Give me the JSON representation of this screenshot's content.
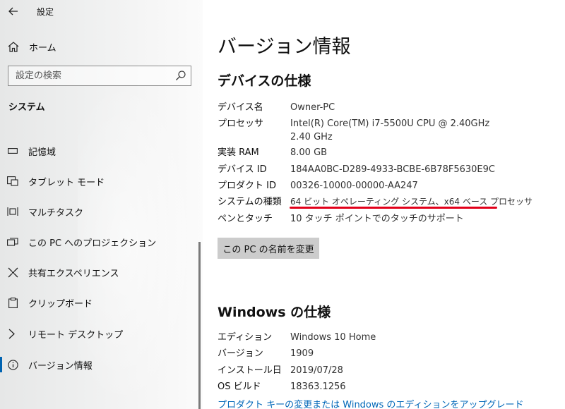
{
  "app": {
    "title": "設定"
  },
  "sidebar": {
    "home_label": "ホーム",
    "search_placeholder": "設定の検索",
    "section_label": "システム",
    "items": [
      {
        "label": "記憶域",
        "icon": "storage-icon"
      },
      {
        "label": "タブレット モード",
        "icon": "tablet-mode-icon"
      },
      {
        "label": "マルチタスク",
        "icon": "multitasking-icon"
      },
      {
        "label": "この PC へのプロジェクション",
        "icon": "projection-icon"
      },
      {
        "label": "共有エクスペリエンス",
        "icon": "shared-experiences-icon"
      },
      {
        "label": "クリップボード",
        "icon": "clipboard-icon"
      },
      {
        "label": "リモート デスクトップ",
        "icon": "remote-desktop-icon"
      },
      {
        "label": "バージョン情報",
        "icon": "info-icon",
        "active": true
      }
    ]
  },
  "main": {
    "title": "バージョン情報",
    "device_spec": {
      "heading": "デバイスの仕様",
      "rows": [
        {
          "key": "デバイス名",
          "value": "Owner-PC"
        },
        {
          "key": "プロセッサ",
          "value": "Intel(R) Core(TM) i7-5500U CPU @ 2.40GHz 2.40 GHz"
        },
        {
          "key": "実装 RAM",
          "value": "8.00 GB"
        },
        {
          "key": "デバイス ID",
          "value": "184AA0BC-D289-4933-BCBE-6B78F5630E9C"
        },
        {
          "key": "プロダクト ID",
          "value": "00326-10000-00000-AA247"
        },
        {
          "key": "システムの種類",
          "value": "64 ビット オペレーティング システム、x64 ベース プロセッサ"
        },
        {
          "key": "ペンとタッチ",
          "value": "10 タッチ ポイントでのタッチのサポート"
        }
      ],
      "rename_button": "この PC の名前を変更"
    },
    "windows_spec": {
      "heading": "Windows の仕様",
      "rows": [
        {
          "key": "エディション",
          "value": "Windows 10 Home"
        },
        {
          "key": "バージョン",
          "value": "1909"
        },
        {
          "key": "インストール日",
          "value": "2019/07/28"
        },
        {
          "key": "OS ビルド",
          "value": "18363.1256"
        }
      ],
      "link": "プロダクト キーの変更または Windows のエディションをアップグレード"
    }
  },
  "colors": {
    "accent": "#0063b1",
    "link": "#0067b8",
    "highlight_underline": "#e2001a"
  }
}
